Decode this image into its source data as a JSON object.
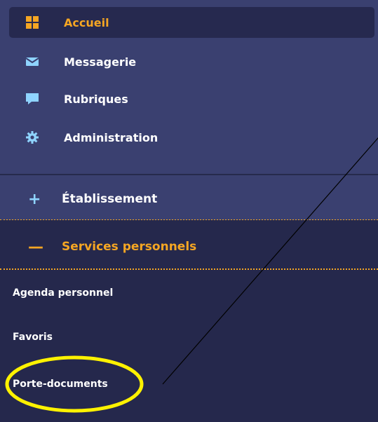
{
  "menu": {
    "items": [
      {
        "label": "Accueil",
        "icon": "home-grid-icon"
      },
      {
        "label": "Messagerie",
        "icon": "envelope-icon"
      },
      {
        "label": "Rubriques",
        "icon": "chat-bubble-icon"
      },
      {
        "label": "Administration",
        "icon": "gear-icon"
      }
    ]
  },
  "sections": {
    "etablissement": {
      "sign": "+",
      "label": "Établissement"
    },
    "services": {
      "sign": "—",
      "label": "Services personnels",
      "items": [
        {
          "label": "Agenda personnel"
        },
        {
          "label": "Favoris"
        },
        {
          "label": "Porte-documents"
        }
      ]
    }
  },
  "colors": {
    "panel": "#3a4070",
    "sub_panel": "#25284c",
    "accent": "#f5a623",
    "highlight_circle": "#fff200"
  }
}
